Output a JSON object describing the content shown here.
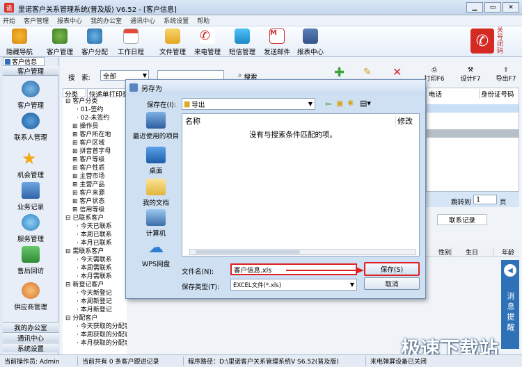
{
  "window": {
    "title": "里诺客户关系管理系统(普及版) V6.52 - [客户信息]"
  },
  "menu": [
    "开始",
    "客户管理",
    "报表中心",
    "我的办公室",
    "通讯中心",
    "系统设置",
    "帮助"
  ],
  "toolbar": {
    "items": [
      "隐藏导航",
      "客户管理",
      "客户分配",
      "工作日程",
      "文件管理",
      "来电管理",
      "短信管理",
      "发送邮件",
      "报表中心"
    ],
    "close_label": "关\n号\n闭\n码"
  },
  "sidebar": {
    "tab": "客户信息",
    "header": "客户管理",
    "items": [
      "客户管理",
      "联系人管理",
      "机会管理",
      "业务记录",
      "服务管理",
      "售后回访",
      "供应商管理"
    ],
    "bottom": [
      "我的办公室",
      "通讯中心",
      "系统设置"
    ]
  },
  "search": {
    "label": "搜　索:",
    "value": "全部",
    "button": "搜索"
  },
  "tabs": {
    "category": "分类",
    "quick": "快递单打印类"
  },
  "tree": [
    "客户分类",
    "01-签约",
    "02-未签约",
    "操作员",
    "客户所在地",
    "客户区域",
    "拼音首字母",
    "客户等级",
    "客户性质",
    "主营市场",
    "主营产品",
    "客户来源",
    "客户状态",
    "信用等级",
    "已联系客户",
    "今天已联系",
    "本周已联系",
    "本月已联系",
    "需联系客户",
    "今天需联系",
    "本周需联系",
    "本月需联系",
    "新登记客户",
    "今天新登记",
    "本周新登记",
    "本月新登记",
    "分配客户",
    "今天获取的分配客户",
    "本周获取的分配客户",
    "本月获取的分配客户"
  ],
  "grid": {
    "actions": [
      "打印F6",
      "设计F7",
      "导出F7"
    ],
    "headers": [
      "电话",
      "身份证号码"
    ],
    "jump_label": "跳转到",
    "page_value": "1",
    "page_unit": "页",
    "contact_tab": "联系记录",
    "sub_headers": [
      "性别",
      "生日",
      "年龄"
    ]
  },
  "message": {
    "label": "消息提醒"
  },
  "dialog": {
    "title": "另存为",
    "save_in_label": "保存在(I):",
    "save_in_value": "导出",
    "places": [
      "最近使用的项目",
      "桌面",
      "我的文档",
      "计算机",
      "WPS网盘"
    ],
    "col_name": "名称",
    "col_modified": "修改",
    "empty_msg": "没有与搜索条件匹配的项。",
    "filename_label": "文件名(N):",
    "filename_value": "客户信息.xls",
    "filetype_label": "保存类型(T):",
    "filetype_value": "EXCEL文件(*.xls)",
    "save_button": "保存(S)",
    "cancel_button": "取消"
  },
  "status": [
    "当前操作员: Admin",
    "当前共有 0 条客户跟进记录",
    "程序路径：D:\\里诺客户关系管理系统V S6.52(普及版)",
    "来电弹屏设备已关闭"
  ],
  "watermark": "极速下载站",
  "colors": {
    "accent": "#2f71b7",
    "highlight_red": "#e02020"
  }
}
